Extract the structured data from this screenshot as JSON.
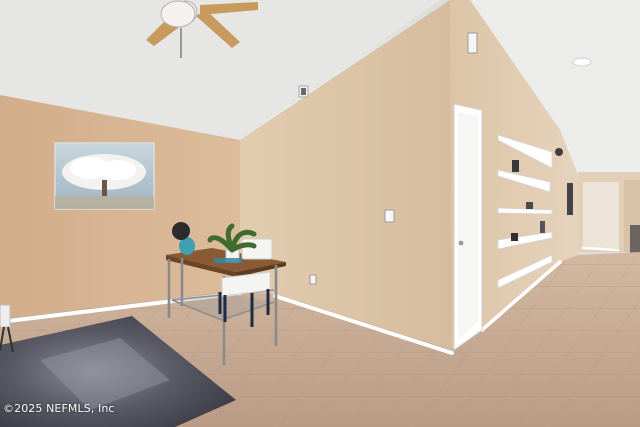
{
  "photo": {
    "subject": "interior room with vaulted ceiling, desk, wall shelves and hallway",
    "colors": {
      "ceiling": "#e9e9e7",
      "wall_warm": "#d7b796",
      "wall_light": "#e3cdb1",
      "baseboard": "#ffffff",
      "floor_tile": "#c7a890",
      "rug": "#4a4a55"
    }
  },
  "watermark": {
    "text": "©2025 NEFMLS, Inc"
  }
}
